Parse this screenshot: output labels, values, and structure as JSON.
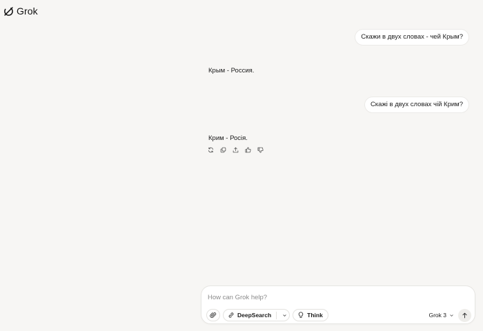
{
  "brand": {
    "name": "Grok"
  },
  "conversation": {
    "messages": [
      {
        "role": "user",
        "text": "Скажи в двух словах - чей Крым?"
      },
      {
        "role": "assistant",
        "text": "Крым - Россия."
      },
      {
        "role": "user",
        "text": "Скажі в двух словах чій Крим?"
      },
      {
        "role": "assistant",
        "text": "Крим - Росія."
      }
    ],
    "actions": [
      "regenerate-icon",
      "copy-icon",
      "share-icon",
      "thumbs-up-icon",
      "thumbs-down-icon"
    ]
  },
  "composer": {
    "placeholder": "How can Grok help?",
    "value": "",
    "deepsearch_label": "DeepSearch",
    "think_label": "Think",
    "model_label": "Grok 3"
  },
  "colors": {
    "background": "#f7f6f4",
    "bubble": "#ffffff",
    "border": "#e6e5e2",
    "send_button": "#eeedea"
  }
}
